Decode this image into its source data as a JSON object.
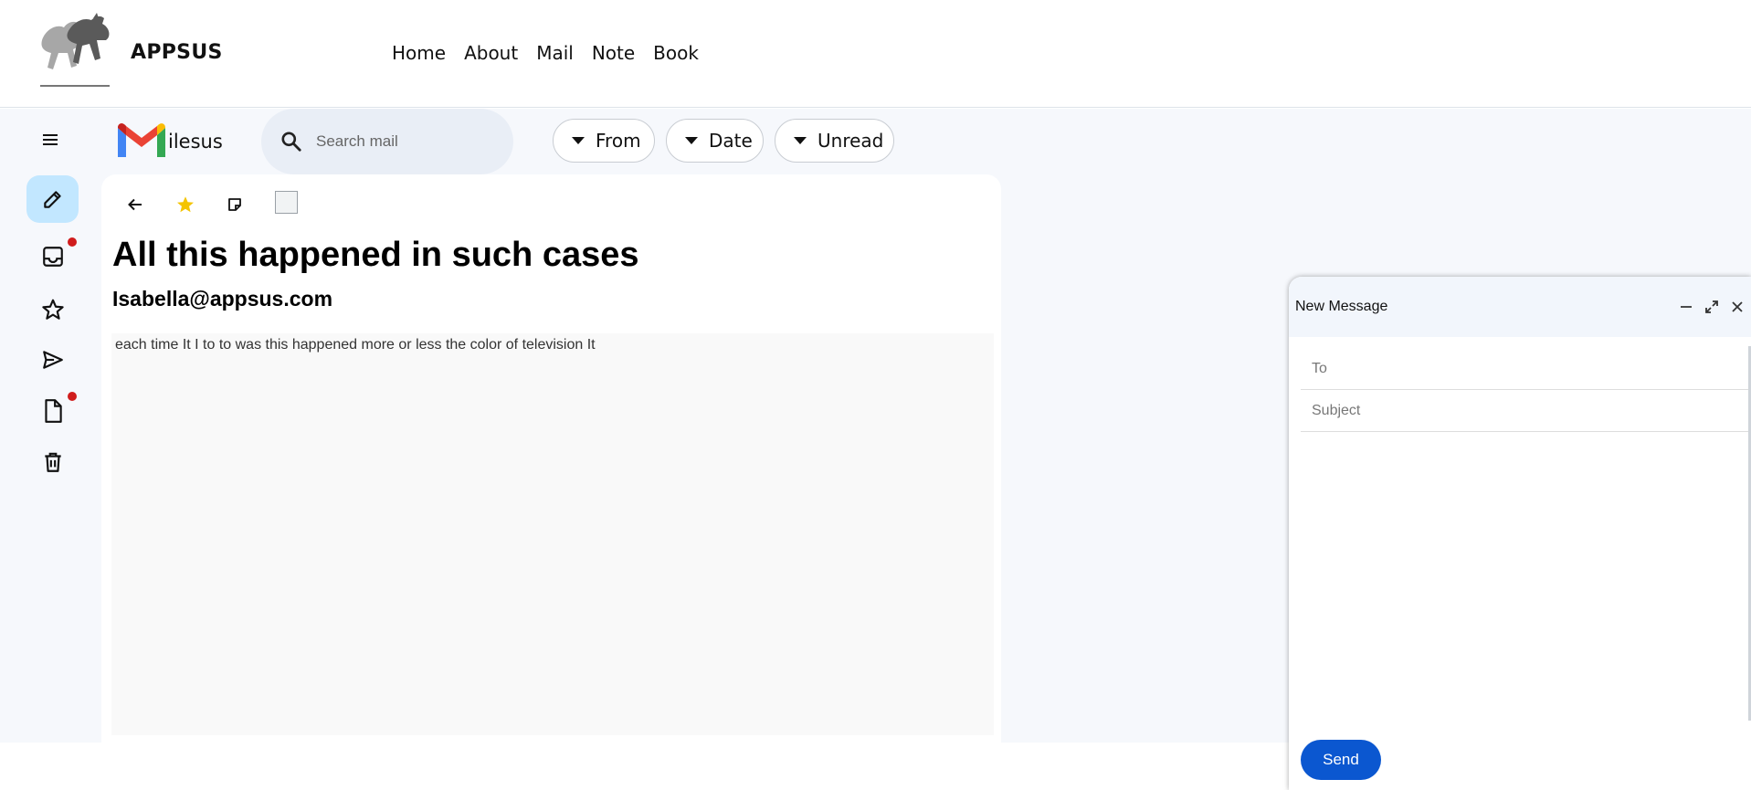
{
  "header": {
    "brand": "APPSUS",
    "nav": [
      {
        "label": "Home"
      },
      {
        "label": "About"
      },
      {
        "label": "Mail"
      },
      {
        "label": "Note"
      },
      {
        "label": "Book"
      }
    ]
  },
  "sidebar": {
    "menu_icon": "hamburger-icon",
    "items": [
      {
        "name": "compose",
        "icon": "pencil-icon",
        "active": true
      },
      {
        "name": "inbox",
        "icon": "inbox-icon",
        "unread_dot": true
      },
      {
        "name": "starred",
        "icon": "star-icon"
      },
      {
        "name": "sent",
        "icon": "send-icon"
      },
      {
        "name": "drafts",
        "icon": "file-icon",
        "unread_dot": true
      },
      {
        "name": "trash",
        "icon": "trash-icon"
      }
    ],
    "dot_color": "#d01c1c",
    "active_bg": "#c2e7ff"
  },
  "mail_app": {
    "logo_text": "ilesus",
    "search": {
      "placeholder": "Search mail",
      "value": ""
    },
    "filters": [
      {
        "label": "From"
      },
      {
        "label": "Date"
      },
      {
        "label": "Unread"
      }
    ]
  },
  "mail_detail": {
    "starred": true,
    "subject": "All this happened in such cases",
    "from": "Isabella@appsus.com",
    "body": "each time It I to to was this happened more or less the color of television It"
  },
  "compose": {
    "title": "New Message",
    "to": {
      "placeholder": "To",
      "value": ""
    },
    "subject": {
      "placeholder": "Subject",
      "value": ""
    },
    "send_label": "Send",
    "send_color": "#0b57d0"
  },
  "colors": {
    "app_bg": "#f6f8fc",
    "search_bg": "#e9eef6",
    "star": "#f4c400"
  }
}
